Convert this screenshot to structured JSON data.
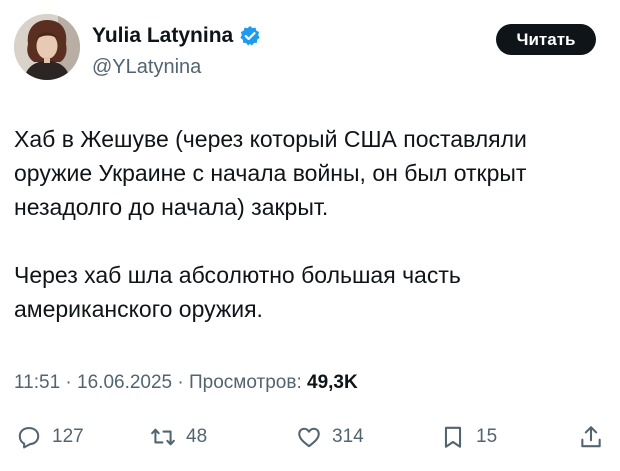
{
  "author": {
    "name": "Yulia Latynina",
    "handle": "@YLatynina",
    "verified": true,
    "verified_color": "#1d9bf0",
    "avatar_icon": "user-avatar-photo"
  },
  "follow_button": {
    "label": "Читать"
  },
  "tweet": {
    "paragraphs": [
      {
        "lines": [
          "Хаб в Жешуве (через который США поставляли",
          "оружие Украине с начала войны, он был открыт",
          "незадолго до начала)  закрыт."
        ]
      },
      {
        "lines": [
          "Через хаб шла абсолютно большая часть",
          "американского оружия."
        ]
      }
    ]
  },
  "meta": {
    "time": "11:51",
    "date": "16.06.2025",
    "views_label": "Просмотров:",
    "views_count": "49,3K"
  },
  "actions": {
    "reply": {
      "icon": "reply-icon",
      "count": "127"
    },
    "repost": {
      "icon": "repost-icon",
      "count": "48"
    },
    "like": {
      "icon": "heart-icon",
      "count": "314"
    },
    "bookmark": {
      "icon": "bookmark-icon",
      "count": "15"
    },
    "share": {
      "icon": "share-icon"
    }
  },
  "colors": {
    "text_primary": "#0f1419",
    "text_secondary": "#536471",
    "button_bg": "#0f1419",
    "button_text": "#ffffff"
  }
}
